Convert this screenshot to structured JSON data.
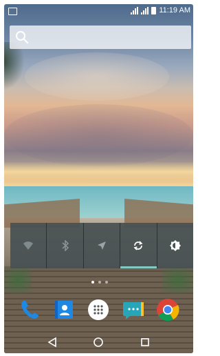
{
  "status_bar": {
    "time": "11:19 AM",
    "icons": [
      "screenshot-icon",
      "signal-icon",
      "signal-icon",
      "battery-icon"
    ]
  },
  "search": {
    "icon": "search-icon"
  },
  "quick_settings": {
    "tiles": [
      {
        "name": "wifi",
        "icon": "wifi-icon",
        "active": false
      },
      {
        "name": "bluetooth",
        "icon": "bluetooth-icon",
        "active": false
      },
      {
        "name": "location",
        "icon": "location-icon",
        "active": false
      },
      {
        "name": "auto-rotate",
        "icon": "sync-icon",
        "active": true
      },
      {
        "name": "brightness",
        "icon": "brightness-icon",
        "active": false
      }
    ],
    "accent_color": "#80cbc4"
  },
  "page_indicator": {
    "pages": 3,
    "current": 1
  },
  "dock": {
    "apps": [
      {
        "name": "phone",
        "icon": "phone-icon",
        "color": "#1e88e5"
      },
      {
        "name": "contacts",
        "icon": "contacts-icon",
        "color": "#1e88e5"
      },
      {
        "name": "app-drawer",
        "icon": "app-drawer-icon",
        "color": "#ffffff"
      },
      {
        "name": "messaging",
        "icon": "messaging-icon",
        "color": "#26a6b8"
      },
      {
        "name": "chrome",
        "icon": "chrome-icon",
        "color": "#db4437"
      }
    ]
  },
  "nav_bar": {
    "buttons": [
      "back-icon",
      "home-icon",
      "recents-icon"
    ]
  }
}
